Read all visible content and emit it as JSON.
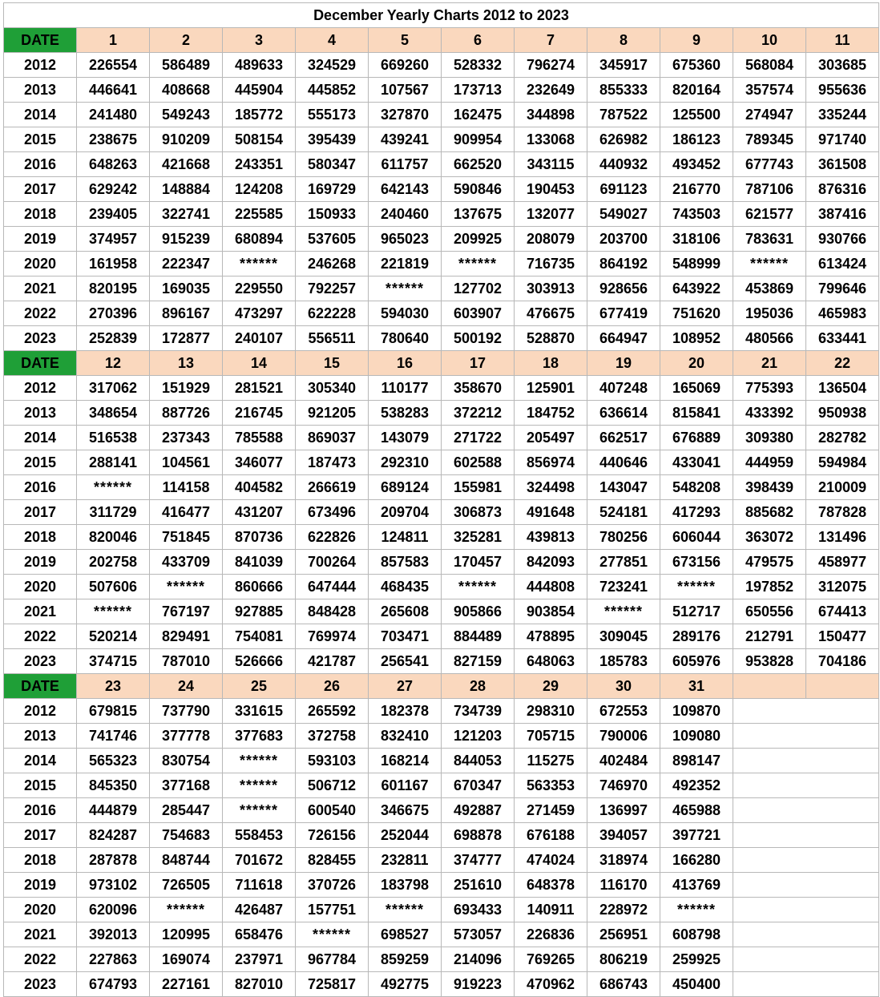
{
  "title": "December Yearly Charts 2012 to 2023",
  "date_label": "DATE",
  "years": [
    "2012",
    "2013",
    "2014",
    "2015",
    "2016",
    "2017",
    "2018",
    "2019",
    "2020",
    "2021",
    "2022",
    "2023"
  ],
  "sections": [
    {
      "days": [
        "1",
        "2",
        "3",
        "4",
        "5",
        "6",
        "7",
        "8",
        "9",
        "10",
        "11"
      ],
      "rows": [
        [
          "226554",
          "586489",
          "489633",
          "324529",
          "669260",
          "528332",
          "796274",
          "345917",
          "675360",
          "568084",
          "303685"
        ],
        [
          "446641",
          "408668",
          "445904",
          "445852",
          "107567",
          "173713",
          "232649",
          "855333",
          "820164",
          "357574",
          "955636"
        ],
        [
          "241480",
          "549243",
          "185772",
          "555173",
          "327870",
          "162475",
          "344898",
          "787522",
          "125500",
          "274947",
          "335244"
        ],
        [
          "238675",
          "910209",
          "508154",
          "395439",
          "439241",
          "909954",
          "133068",
          "626982",
          "186123",
          "789345",
          "971740"
        ],
        [
          "648263",
          "421668",
          "243351",
          "580347",
          "611757",
          "662520",
          "343115",
          "440932",
          "493452",
          "677743",
          "361508"
        ],
        [
          "629242",
          "148884",
          "124208",
          "169729",
          "642143",
          "590846",
          "190453",
          "691123",
          "216770",
          "787106",
          "876316"
        ],
        [
          "239405",
          "322741",
          "225585",
          "150933",
          "240460",
          "137675",
          "132077",
          "549027",
          "743503",
          "621577",
          "387416"
        ],
        [
          "374957",
          "915239",
          "680894",
          "537605",
          "965023",
          "209925",
          "208079",
          "203700",
          "318106",
          "783631",
          "930766"
        ],
        [
          "161958",
          "222347",
          "******",
          "246268",
          "221819",
          "******",
          "716735",
          "864192",
          "548999",
          "******",
          "613424"
        ],
        [
          "820195",
          "169035",
          "229550",
          "792257",
          "******",
          "127702",
          "303913",
          "928656",
          "643922",
          "453869",
          "799646"
        ],
        [
          "270396",
          "896167",
          "473297",
          "622228",
          "594030",
          "603907",
          "476675",
          "677419",
          "751620",
          "195036",
          "465983"
        ],
        [
          "252839",
          "172877",
          "240107",
          "556511",
          "780640",
          "500192",
          "528870",
          "664947",
          "108952",
          "480566",
          "633441"
        ]
      ]
    },
    {
      "days": [
        "12",
        "13",
        "14",
        "15",
        "16",
        "17",
        "18",
        "19",
        "20",
        "21",
        "22"
      ],
      "rows": [
        [
          "317062",
          "151929",
          "281521",
          "305340",
          "110177",
          "358670",
          "125901",
          "407248",
          "165069",
          "775393",
          "136504"
        ],
        [
          "348654",
          "887726",
          "216745",
          "921205",
          "538283",
          "372212",
          "184752",
          "636614",
          "815841",
          "433392",
          "950938"
        ],
        [
          "516538",
          "237343",
          "785588",
          "869037",
          "143079",
          "271722",
          "205497",
          "662517",
          "676889",
          "309380",
          "282782"
        ],
        [
          "288141",
          "104561",
          "346077",
          "187473",
          "292310",
          "602588",
          "856974",
          "440646",
          "433041",
          "444959",
          "594984"
        ],
        [
          "******",
          "114158",
          "404582",
          "266619",
          "689124",
          "155981",
          "324498",
          "143047",
          "548208",
          "398439",
          "210009"
        ],
        [
          "311729",
          "416477",
          "431207",
          "673496",
          "209704",
          "306873",
          "491648",
          "524181",
          "417293",
          "885682",
          "787828"
        ],
        [
          "820046",
          "751845",
          "870736",
          "622826",
          "124811",
          "325281",
          "439813",
          "780256",
          "606044",
          "363072",
          "131496"
        ],
        [
          "202758",
          "433709",
          "841039",
          "700264",
          "857583",
          "170457",
          "842093",
          "277851",
          "673156",
          "479575",
          "458977"
        ],
        [
          "507606",
          "******",
          "860666",
          "647444",
          "468435",
          "******",
          "444808",
          "723241",
          "******",
          "197852",
          "312075"
        ],
        [
          "******",
          "767197",
          "927885",
          "848428",
          "265608",
          "905866",
          "903854",
          "******",
          "512717",
          "650556",
          "674413"
        ],
        [
          "520214",
          "829491",
          "754081",
          "769974",
          "703471",
          "884489",
          "478895",
          "309045",
          "289176",
          "212791",
          "150477"
        ],
        [
          "374715",
          "787010",
          "526666",
          "421787",
          "256541",
          "827159",
          "648063",
          "185783",
          "605976",
          "953828",
          "704186"
        ]
      ]
    },
    {
      "days": [
        "23",
        "24",
        "25",
        "26",
        "27",
        "28",
        "29",
        "30",
        "31",
        "",
        ""
      ],
      "rows": [
        [
          "679815",
          "737790",
          "331615",
          "265592",
          "182378",
          "734739",
          "298310",
          "672553",
          "109870"
        ],
        [
          "741746",
          "377778",
          "377683",
          "372758",
          "832410",
          "121203",
          "705715",
          "790006",
          "109080"
        ],
        [
          "565323",
          "830754",
          "******",
          "593103",
          "168214",
          "844053",
          "115275",
          "402484",
          "898147"
        ],
        [
          "845350",
          "377168",
          "******",
          "506712",
          "601167",
          "670347",
          "563353",
          "746970",
          "492352"
        ],
        [
          "444879",
          "285447",
          "******",
          "600540",
          "346675",
          "492887",
          "271459",
          "136997",
          "465988"
        ],
        [
          "824287",
          "754683",
          "558453",
          "726156",
          "252044",
          "698878",
          "676188",
          "394057",
          "397721"
        ],
        [
          "287878",
          "848744",
          "701672",
          "828455",
          "232811",
          "374777",
          "474024",
          "318974",
          "166280"
        ],
        [
          "973102",
          "726505",
          "711618",
          "370726",
          "183798",
          "251610",
          "648378",
          "116170",
          "413769"
        ],
        [
          "620096",
          "******",
          "426487",
          "157751",
          "******",
          "693433",
          "140911",
          "228972",
          "******"
        ],
        [
          "392013",
          "120995",
          "658476",
          "******",
          "698527",
          "573057",
          "226836",
          "256951",
          "608798"
        ],
        [
          "227863",
          "169074",
          "237971",
          "967784",
          "859259",
          "214096",
          "769265",
          "806219",
          "259925"
        ],
        [
          "674793",
          "227161",
          "827010",
          "725817",
          "492775",
          "919223",
          "470962",
          "686743",
          "450400"
        ]
      ]
    }
  ]
}
